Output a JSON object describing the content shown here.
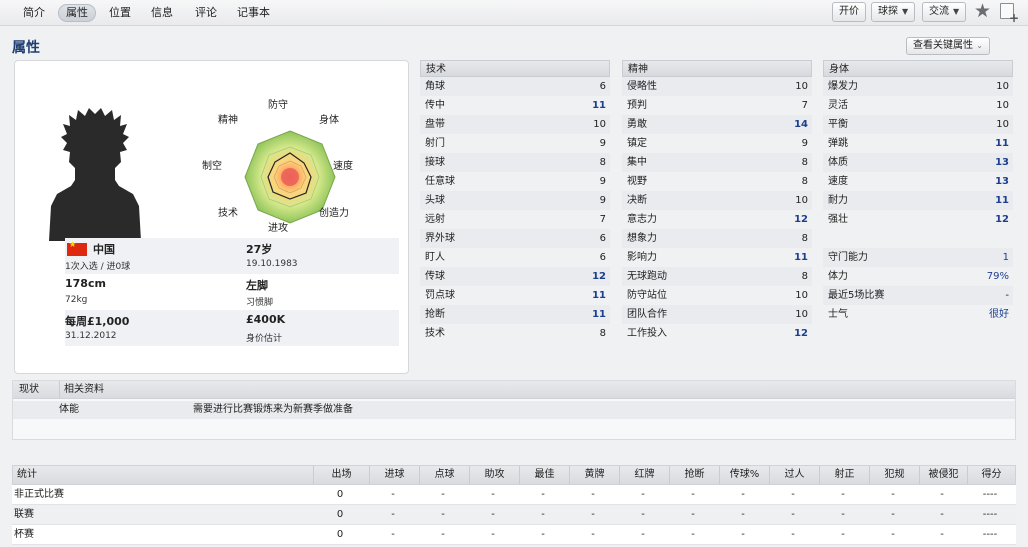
{
  "tabs": [
    "简介",
    "属性",
    "位置",
    "信息",
    "评论",
    "记事本"
  ],
  "active_tab": "属性",
  "toolbar": {
    "offer": "开价",
    "scout": "球探",
    "interact": "交流"
  },
  "page_title": "属性",
  "key_attr_button": "查看关键属性",
  "radar_labels": {
    "defence": "防守",
    "physical": "身体",
    "speed": "速度",
    "creativity": "创造力",
    "attack": "进攻",
    "technique": "技术",
    "set_pieces": "制空",
    "mental": "精神"
  },
  "player_info": {
    "nation": "中国",
    "caps": "1次入选 / 进0球",
    "age": "27岁",
    "dob": "19.10.1983",
    "height": "178cm",
    "weight": "72kg",
    "foot": "左脚",
    "foot_label": "习惯脚",
    "wage": "每周£1,000",
    "contract": "31.12.2012",
    "value": "£400K",
    "value_label": "身价估计"
  },
  "technical": {
    "title": "技术",
    "rows": [
      {
        "name": "角球",
        "value": "6"
      },
      {
        "name": "传中",
        "value": "11"
      },
      {
        "name": "盘带",
        "value": "10"
      },
      {
        "name": "射门",
        "value": "9"
      },
      {
        "name": "接球",
        "value": "8"
      },
      {
        "name": "任意球",
        "value": "9"
      },
      {
        "name": "头球",
        "value": "9"
      },
      {
        "name": "远射",
        "value": "7"
      },
      {
        "name": "界外球",
        "value": "6"
      },
      {
        "name": "盯人",
        "value": "6"
      },
      {
        "name": "传球",
        "value": "12"
      },
      {
        "name": "罚点球",
        "value": "11"
      },
      {
        "name": "抢断",
        "value": "11"
      },
      {
        "name": "技术",
        "value": "8"
      }
    ]
  },
  "mental": {
    "title": "精神",
    "rows": [
      {
        "name": "侵略性",
        "value": "10"
      },
      {
        "name": "预判",
        "value": "7"
      },
      {
        "name": "勇敢",
        "value": "14"
      },
      {
        "name": "镇定",
        "value": "9"
      },
      {
        "name": "集中",
        "value": "8"
      },
      {
        "name": "视野",
        "value": "8"
      },
      {
        "name": "决断",
        "value": "10"
      },
      {
        "name": "意志力",
        "value": "12"
      },
      {
        "name": "想象力",
        "value": "8"
      },
      {
        "name": "影响力",
        "value": "11"
      },
      {
        "name": "无球跑动",
        "value": "8"
      },
      {
        "name": "防守站位",
        "value": "10"
      },
      {
        "name": "团队合作",
        "value": "10"
      },
      {
        "name": "工作投入",
        "value": "12"
      }
    ]
  },
  "physical": {
    "title": "身体",
    "rows": [
      {
        "name": "爆发力",
        "value": "10"
      },
      {
        "name": "灵活",
        "value": "10"
      },
      {
        "name": "平衡",
        "value": "10"
      },
      {
        "name": "弹跳",
        "value": "11"
      },
      {
        "name": "体质",
        "value": "13"
      },
      {
        "name": "速度",
        "value": "13"
      },
      {
        "name": "耐力",
        "value": "11"
      },
      {
        "name": "强壮",
        "value": "12"
      }
    ],
    "extra": [
      {
        "name": "守门能力",
        "value": "1"
      },
      {
        "name": "体力",
        "value": "79%"
      },
      {
        "name": "最近5场比赛",
        "value": "-"
      },
      {
        "name": "士气",
        "value": "很好"
      }
    ]
  },
  "status": {
    "col1": "现状",
    "col2": "相关资料",
    "row_label": "体能",
    "row_text": "需要进行比赛锻炼来为新赛季做准备"
  },
  "stats": {
    "headers": [
      "统计",
      "出场",
      "进球",
      "点球",
      "助攻",
      "最佳",
      "黄牌",
      "红牌",
      "抢断",
      "传球%",
      "过人",
      "射正",
      "犯规",
      "被侵犯",
      "得分"
    ],
    "rows": [
      {
        "label": "非正式比赛",
        "apps": "0",
        "cells": [
          "-",
          "-",
          "-",
          "-",
          "-",
          "-",
          "-",
          "-",
          "-",
          "-",
          "-",
          "-",
          "----"
        ]
      },
      {
        "label": "联赛",
        "apps": "0",
        "cells": [
          "-",
          "-",
          "-",
          "-",
          "-",
          "-",
          "-",
          "-",
          "-",
          "-",
          "-",
          "-",
          "----"
        ]
      },
      {
        "label": "杯赛",
        "apps": "0",
        "cells": [
          "-",
          "-",
          "-",
          "-",
          "-",
          "-",
          "-",
          "-",
          "-",
          "-",
          "-",
          "-",
          "----"
        ]
      }
    ]
  }
}
